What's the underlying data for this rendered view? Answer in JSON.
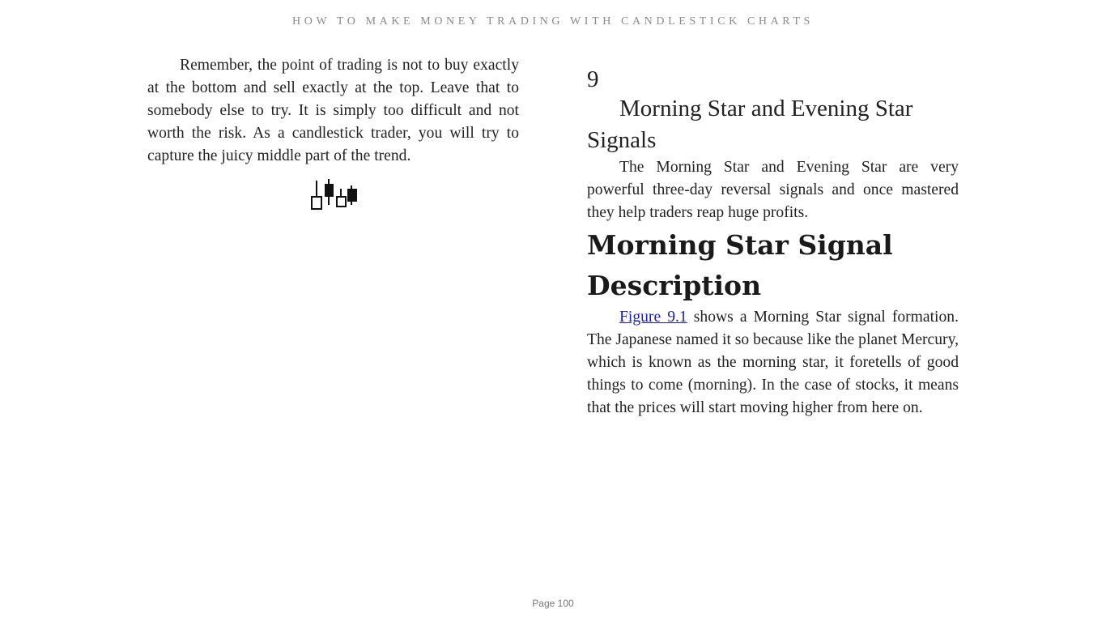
{
  "book": {
    "running_header": "HOW TO MAKE MONEY TRADING WITH CANDLESTICK CHARTS"
  },
  "left_page": {
    "paragraph": "Remember, the point of trading is not to buy exactly at the bottom and sell exactly at the top. Leave that to somebody else to try. It is simply too difficult and not worth the risk. As a candlestick trader, you will try to capture the juicy middle part of the trend.",
    "ornament_icon": "candlestick-ornament-icon"
  },
  "right_page": {
    "chapter_number": "9",
    "chapter_title": "Morning Star and Evening Star Signals",
    "chapter_intro": "The Morning Star and Evening Star are very powerful three-day reversal signals and once mastered they help traders reap huge profits.",
    "section_title": "Morning Star Signal Description",
    "section_link_text": "Figure 9.1",
    "section_body_rest": " shows a Morning Star signal formation. The Japanese named it so because like the planet Mercury, which is known as the morning star, it foretells of good things to come (morning). In the case of stocks, it means that the prices will start moving higher from here on."
  },
  "footer": {
    "page_label": "Page 100"
  },
  "colors": {
    "link": "#1a1acc",
    "header_text": "#8a8a8a",
    "body_text": "#222222"
  }
}
